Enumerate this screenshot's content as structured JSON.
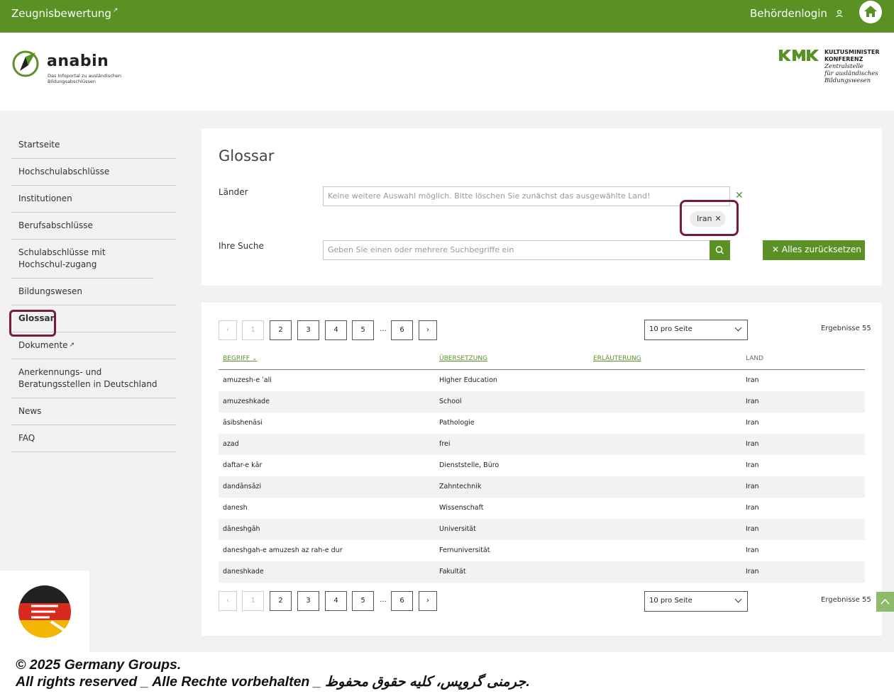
{
  "topbar": {
    "left_link": "Zeugnisbewertung",
    "right_link": "Behördenlogin",
    "brand_color": "#5a9124"
  },
  "header": {
    "logo_name": "anabin",
    "logo_tagline": "Das Infoportal zu ausländischen Bildungsabschlüssen",
    "kmk_line1": "KULTUSMINISTER",
    "kmk_line2": "KONFERENZ",
    "kmk_line3": "Zentralstelle",
    "kmk_line4": "für ausländisches",
    "kmk_line5": "Bildungswesen"
  },
  "sidebar": {
    "items": [
      {
        "label": "Startseite"
      },
      {
        "label": "Hochschulabschlüsse"
      },
      {
        "label": "Institutionen"
      },
      {
        "label": "Berufsabschlüsse"
      },
      {
        "label": "Schulabschlüsse mit Hochschul-zugang"
      },
      {
        "label": "Bildungswesen"
      },
      {
        "label": "Glossar"
      },
      {
        "label": "Dokumente"
      },
      {
        "label": "Anerkennungs- und Beratungsstellen in Deutschland"
      },
      {
        "label": "News"
      },
      {
        "label": "FAQ"
      }
    ]
  },
  "search": {
    "title": "Glossar",
    "countries_label": "Länder",
    "countries_placeholder": "Keine weitere Auswahl möglich. Bitte löschen Sie zunächst das ausgewählte Land!",
    "selected_country": "Iran",
    "query_label": "Ihre Suche",
    "query_placeholder": "Geben Sie einen oder mehrere Suchbegriffe ein",
    "reset_label": "Alles zurücksetzen"
  },
  "results": {
    "pages": [
      "1",
      "2",
      "3",
      "4",
      "5",
      "...",
      "6"
    ],
    "current_page": "1",
    "per_page": "10 pro Seite",
    "count_label": "Ergebnisse 55",
    "columns": [
      "BEGRIFF",
      "ÜBERSETZUNG",
      "ERLÄUTERUNG",
      "LAND"
    ],
    "rows": [
      {
        "term": "amuzesh-e ˈali",
        "translation": "Higher Education",
        "explanation": "",
        "country": "Iran"
      },
      {
        "term": "amuzeshkade",
        "translation": "School",
        "explanation": "",
        "country": "Iran"
      },
      {
        "term": "āsibshenāsi",
        "translation": "Pathologie",
        "explanation": "",
        "country": "Iran"
      },
      {
        "term": "azad",
        "translation": "frei",
        "explanation": "",
        "country": "Iran"
      },
      {
        "term": "daftar-e kār",
        "translation": "Dienststelle, Büro",
        "explanation": "",
        "country": "Iran"
      },
      {
        "term": "dandānsāzi",
        "translation": "Zahntechnik",
        "explanation": "",
        "country": "Iran"
      },
      {
        "term": "danesh",
        "translation": "Wissenschaft",
        "explanation": "",
        "country": "Iran"
      },
      {
        "term": "dāneshgāh",
        "translation": "Universität",
        "explanation": "",
        "country": "Iran"
      },
      {
        "term": "daneshgah-e amuzesh az rah-e dur",
        "translation": "Fernuniversität",
        "explanation": "",
        "country": "Iran"
      },
      {
        "term": "daneshkade",
        "translation": "Fakultät",
        "explanation": "",
        "country": "Iran"
      }
    ]
  },
  "footer": {
    "copyright_line1": "© 2025 Germany Groups.",
    "copyright_line2": "All rights reserved _ Alle Rechte vorbehalten _ جرمنی گروپس، کلیه حقوق محفوظ."
  }
}
